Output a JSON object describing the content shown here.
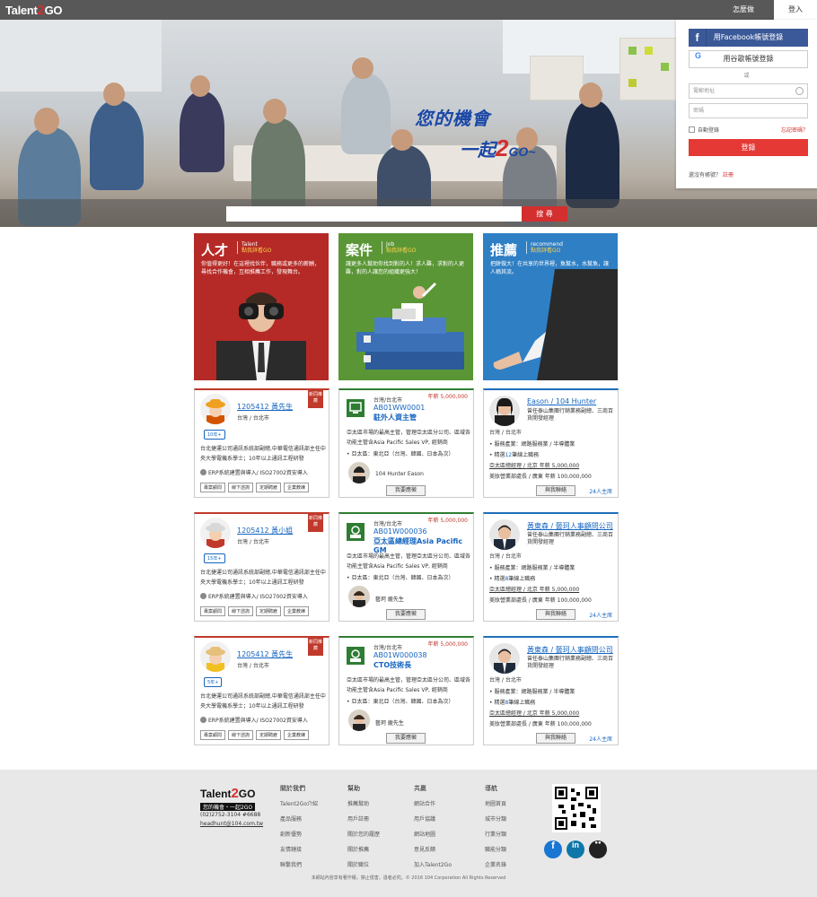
{
  "header": {
    "logo": "Talent",
    "logo_two": "2",
    "logo_go": "GO",
    "howto": "怎麼做",
    "login_tab": "登入"
  },
  "hero": {
    "slogan_line1": "您的機會",
    "slogan_prefix": "一起",
    "slogan_two": "2",
    "slogan_go": "GO~"
  },
  "search": {
    "placeholder": "",
    "button": "搜 尋"
  },
  "login": {
    "facebook": "用Facebook帳號登錄",
    "google": "用谷歌帳號登錄",
    "or": "或",
    "email_placeholder": "電郵地址",
    "password_placeholder": "密碼",
    "remember": "自動登錄",
    "forgot": "忘記密碼？",
    "submit": "登錄",
    "no_account": "還沒有帳號？",
    "register": "註冊"
  },
  "categories": [
    {
      "title": "人才",
      "en": "Talent",
      "sub": "點我詳看GO",
      "desc": "你值得更好！在這裡找伙伴，職務或更多的薪酬，尋找合作機會，互相推薦工作，發現舞台。",
      "color": "#b52a26"
    },
    {
      "title": "案件",
      "en": "Job",
      "sub": "點我詳看GO",
      "desc": "讓更多人幫助你找到對的人！求人難，求對的人更難，對的人讓您的組織更強大！",
      "color": "#5a9636"
    },
    {
      "title": "推薦",
      "en": "recommend",
      "sub": "點我詳看GO",
      "desc": "把餅做大！在共享的世界裡，魚幫水，水幫魚，讓人稱其流。",
      "color": "#2f7fc4"
    }
  ],
  "talents": [
    {
      "name": "1205412  黃先生",
      "loc": "台灣 / 台北市",
      "years": "10年+",
      "badge": "新同推薦",
      "desc": "台北捷運公司通訊系統部副總,中華電信通訊部主任中央大學電機系學士；10年以上通訊工程研發",
      "erp": "ERP系統建置與導入/ ISO27002資安導入",
      "tags": [
        "專案顧問",
        "線下諮詢",
        "定期聘雇",
        "企業教練"
      ],
      "hat": "#f0a020",
      "shirt": "#d35400"
    },
    {
      "name": "1205412  黃小姐",
      "loc": "台灣 / 台北市",
      "years": "15年+",
      "badge": "新同推薦",
      "desc": "台北捷運公司通訊系統部副總,中華電信通訊部主任中央大學電機系學士；10年以上通訊工程研發",
      "erp": "ERP系統建置與導入/ ISO27002資安導入",
      "tags": [
        "專案顧問",
        "線下諮詢",
        "定期聘雇",
        "企業教練"
      ],
      "hat": "#d8d8d8",
      "shirt": "#c0392b"
    },
    {
      "name": "1205412  黃先生",
      "loc": "台灣 / 台北市",
      "years": "5年+",
      "badge": "新同推薦",
      "desc": "台北捷運公司通訊系統部副總,中華電信通訊部主任中央大學電機系學士；10年以上通訊工程研發",
      "erp": "ERP系統建置與導入/ ISO27002資安導入",
      "tags": [
        "專案顧問",
        "線下諮詢",
        "定期聘雇",
        "企業教練"
      ],
      "hat": "#e6c07a",
      "shirt": "#f0c020"
    }
  ],
  "jobs": [
    {
      "loc": "台灣/台北市",
      "salary": "年薪 5,000,000",
      "code": "AB01WW0001",
      "title": "駐外人資主管",
      "desc": "亞太區市場的最高主管，管理亞太區分公司、區域各功能主管含Asia Pacific Sales VP, 經銷商",
      "sub": "• 亞太區：東北亞（台灣、韓國、日本為次）",
      "recruiter": "104 Hunter  Eason",
      "apply": "我要應徵"
    },
    {
      "loc": "台灣/台北市",
      "salary": "年薪 5,000,000",
      "code": "AB01W000036",
      "title": "亞太區總經理Asia Pacific GM",
      "desc": "亞太區市場的最高主管，管理亞太區分公司、區域各功能主管含Asia Pacific Sales VP, 經銷商",
      "sub": "• 亞太區：東北亞（台灣、韓國、日本為次）",
      "recruiter": "藝珂 龐先生",
      "apply": "我要應徵"
    },
    {
      "loc": "台灣/台北市",
      "salary": "年薪 5,000,000",
      "code": "AB01W000038",
      "title": "CTO技術長",
      "desc": "亞太區市場的最高主管，管理亞太區分公司、區域各功能主管含Asia Pacific Sales VP, 經銷商",
      "sub": "• 亞太區：東北亞（台灣、韓國、日本為次）",
      "recruiter": "藝珂 龐先生",
      "apply": "我要應徵"
    }
  ],
  "recommenders": [
    {
      "name": "Eason  / 104 Hunter",
      "title": "曾任泰山集團行銷業務副總、三商百貨開發經理",
      "loc": "台灣 / 台北市",
      "ind": "• 服務產業：網路服務業 / 半導體業",
      "cnt_pre": "• 精選",
      "cnt_num": "12",
      "cnt_post": "筆線上職務",
      "job1": "亞太區總經理 / 北京 年薪  5,000,000",
      "job2": "美妝營業部處長 / 廣東 年薪  100,000,000",
      "contact": "與我聯絡",
      "followers": "24人主席"
    },
    {
      "name": "黃東森 / 藝珂人事顧問公司",
      "title": "曾任泰山集團行銷業務副總、三商百貨開發經理",
      "loc": "台灣 / 台北市",
      "ind": "• 服務產業：網路服務業 / 半導體業",
      "cnt_pre": "• 精選",
      "cnt_num": "8",
      "cnt_post": "筆線上職務",
      "job1": "亞太區總經理 / 北京 年薪  5,000,000",
      "job2": "美妝營業部處長 / 廣東 年薪  100,000,000",
      "contact": "與我聯絡",
      "followers": "24人主席"
    },
    {
      "name": "黃東森 / 藝珂人事顧問公司",
      "title": "曾任泰山集團行銷業務副總、三商百貨開發經理",
      "loc": "台灣 / 台北市",
      "ind": "• 服務產業：網路服務業 / 半導體業",
      "cnt_pre": "• 精選",
      "cnt_num": "8",
      "cnt_post": "筆線上職務",
      "job1": "亞太區總經理 / 北京 年薪  5,000,000",
      "job2": "美妝營業部處長 / 廣東 年薪  100,000,000",
      "contact": "與我聯絡",
      "followers": "24人主席"
    }
  ],
  "footer": {
    "logo": "Talent",
    "logo_two": "2",
    "logo_go": "GO",
    "slogan": "您的機會・一起2GO",
    "phone": "(02)2752-3104 #6688",
    "email": "headhunt@104.com.tw",
    "cols": [
      {
        "head": "關於我們",
        "links": [
          "Talent2Go介紹",
          "產品服務",
          "創新優勢",
          "友情鏈接",
          "聯繫我們"
        ]
      },
      {
        "head": "幫助",
        "links": [
          "推薦幫助",
          "用戶註冊",
          "關於您的履歷",
          "關於推薦",
          "關於職位"
        ]
      },
      {
        "head": "共贏",
        "links": [
          "網站合作",
          "用戶協議",
          "網站地圖",
          "意見反饋",
          "加入Talent2Go"
        ]
      },
      {
        "head": "導航",
        "links": [
          "地圖首頁",
          "城市分類",
          "行業分類",
          "職能分類",
          "企業名錄"
        ]
      }
    ],
    "copyright": "本網站內容享有著作權，禁止侵害，違者必究。© 2016 104 Corporation All Rights Reserved"
  }
}
